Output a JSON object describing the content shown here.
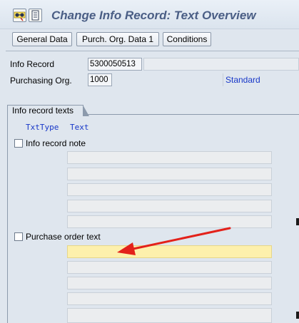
{
  "window": {
    "title": "Change Info Record: Text Overview"
  },
  "toolbar": {
    "icons": [
      "glasses-icon",
      "document-icon"
    ]
  },
  "nav_buttons": [
    "General Data",
    "Purch. Org. Data 1",
    "Conditions"
  ],
  "header": {
    "info_record_label": "Info Record",
    "info_record_value": "5300050513",
    "purch_org_label": "Purchasing Org.",
    "purch_org_value": "1000",
    "purch_org_type": "Standard"
  },
  "texts_section": {
    "tab_label": "Info record texts",
    "col_txttype": "TxtType",
    "col_text": "Text",
    "groups": [
      {
        "label": "Info record note",
        "checked": false,
        "lines": 5
      },
      {
        "label": "Purchase order text",
        "checked": false,
        "lines": 5,
        "active_line": 1
      }
    ]
  },
  "colors": {
    "title_text": "#4a5e85",
    "link_blue": "#1737c8",
    "active_line": "#fdf0ac",
    "arrow": "#e3211a"
  }
}
